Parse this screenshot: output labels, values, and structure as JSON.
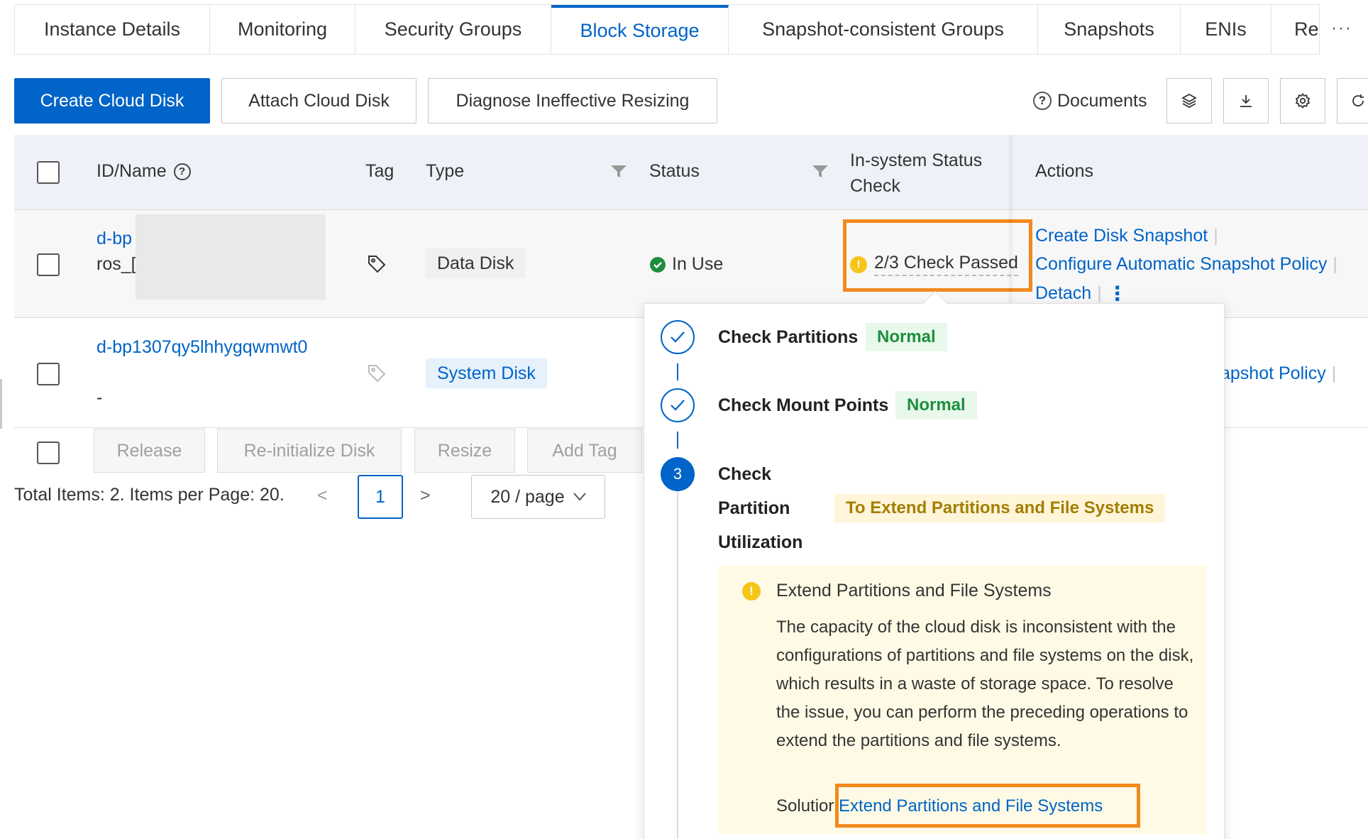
{
  "tabs": [
    {
      "label": "Instance Details"
    },
    {
      "label": "Monitoring"
    },
    {
      "label": "Security Groups"
    },
    {
      "label": "Block Storage"
    },
    {
      "label": "Snapshot-consistent Groups"
    },
    {
      "label": "Snapshots"
    },
    {
      "label": "ENIs"
    },
    {
      "label": "Rer"
    }
  ],
  "tab_more": "···",
  "toolbar": {
    "create": "Create Cloud Disk",
    "attach": "Attach Cloud Disk",
    "diagnose": "Diagnose Ineffective Resizing",
    "documents": "Documents",
    "help_glyph": "?"
  },
  "table": {
    "headers": {
      "id_name": "ID/Name",
      "tag": "Tag",
      "type": "Type",
      "status": "Status",
      "check_line1": "In-system Status",
      "check_line2": "Check",
      "actions": "Actions"
    },
    "rows": [
      {
        "id": "d-bp",
        "name": "ros_[",
        "type": "Data Disk",
        "status": "In Use",
        "check": "2/3 Check Passed",
        "warn_glyph": "!",
        "actions": [
          "Create Disk Snapshot",
          "Configure Automatic Snapshot Policy",
          "Detach"
        ],
        "more_glyph": "⋮"
      },
      {
        "id": "d-bp1307qy5lhhygqwmwt0",
        "name": "-",
        "type": "System Disk",
        "actions_partial": "apshot Policy"
      }
    ],
    "separator": "|"
  },
  "batch": {
    "release": "Release",
    "reinit": "Re-initialize Disk",
    "resize": "Resize",
    "add_tag": "Add Tag"
  },
  "pager": {
    "total": "Total Items: 2. Items per Page: 20.",
    "current": "1",
    "page_size": "20 / page",
    "prev": "<",
    "next": ">"
  },
  "popover": {
    "steps": [
      {
        "title": "Check Partitions",
        "badge": "Normal"
      },
      {
        "title": "Check Mount Points",
        "badge": "Normal"
      },
      {
        "number": "3",
        "title_lines": [
          "Check",
          "Partition",
          "Utilization"
        ],
        "badge": "To Extend Partitions and File Systems"
      }
    ],
    "warning": {
      "glyph": "!",
      "title": "Extend Partitions and File Systems",
      "description": "The capacity of the cloud disk is inconsistent with the configurations of partitions and file systems on the disk, which results in a waste of storage space. To resolve the issue, you can perform the preceding operations to extend the partitions and file systems.",
      "solution_label": "Solutior",
      "solution_colon": ":",
      "solution_link": "Extend Partitions and File Systems"
    }
  },
  "colors": {
    "primary": "#0064c8",
    "highlight_orange": "#f28a1e",
    "success": "#1e8e3e",
    "warning": "#f5c518"
  }
}
